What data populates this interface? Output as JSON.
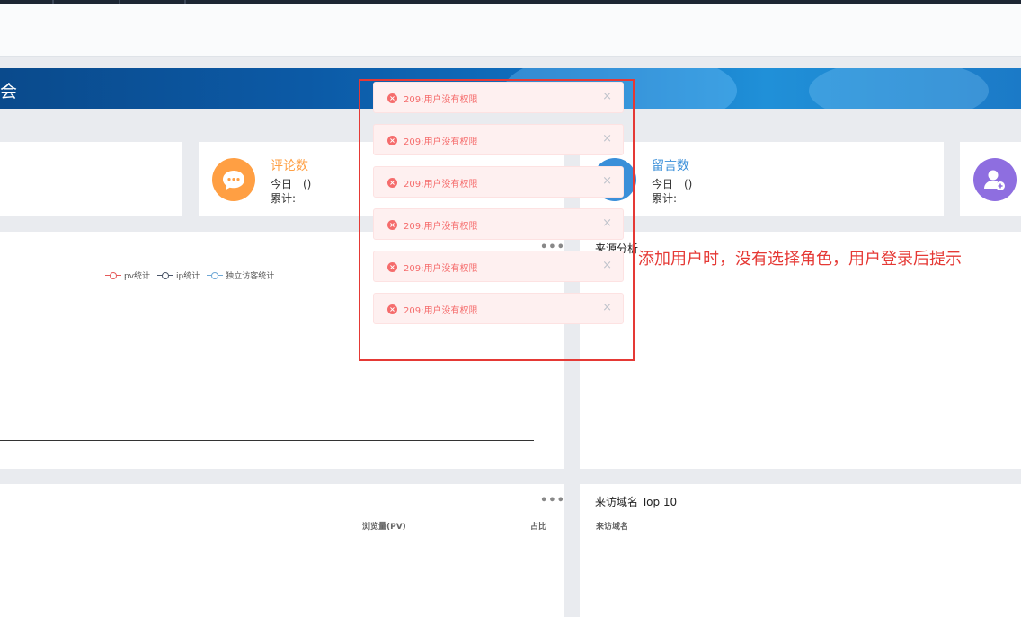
{
  "banner": {
    "title_fragment": "会"
  },
  "stats": [
    {
      "title": "评论数",
      "today": "今日　()",
      "total": "累计:",
      "color": "#ff9f43",
      "icon": "chat-bubble-icon"
    },
    {
      "title": "留言数",
      "today": "今日　()",
      "total": "累计:",
      "color": "#3a8fd9",
      "icon": "message-icon"
    },
    {
      "icon": "add-user-icon",
      "color": "#8e6ee0"
    }
  ],
  "chart_data": {
    "type": "line",
    "title": "",
    "series": [
      {
        "name": "pv统计",
        "color": "#e55b5b",
        "values": []
      },
      {
        "name": "ip统计",
        "color": "#4a5568",
        "values": []
      },
      {
        "name": "独立访客统计",
        "color": "#6fa8d6",
        "values": []
      }
    ]
  },
  "panels": {
    "source_analysis_title": "来源分析",
    "referrer_title": "来访域名 Top 10",
    "referrer_col": "来访域名",
    "pages_col_pv": "浏览量(PV)",
    "pages_col_ratio": "占比"
  },
  "more_glyph": "•••",
  "toasts": [
    {
      "message": "209:用户没有权限"
    },
    {
      "message": "209:用户没有权限"
    },
    {
      "message": "209:用户没有权限"
    },
    {
      "message": "209:用户没有权限"
    },
    {
      "message": "209:用户没有权限"
    },
    {
      "message": "209:用户没有权限"
    }
  ],
  "toast_icon": "error-circle-icon",
  "toast_close_glyph": "×",
  "annotation": "添加用户时，没有选择角色，用户登录后提示",
  "colors": {
    "error": "#f56c6c",
    "annotation": "#e53935",
    "banner": "#0c5aa6"
  }
}
